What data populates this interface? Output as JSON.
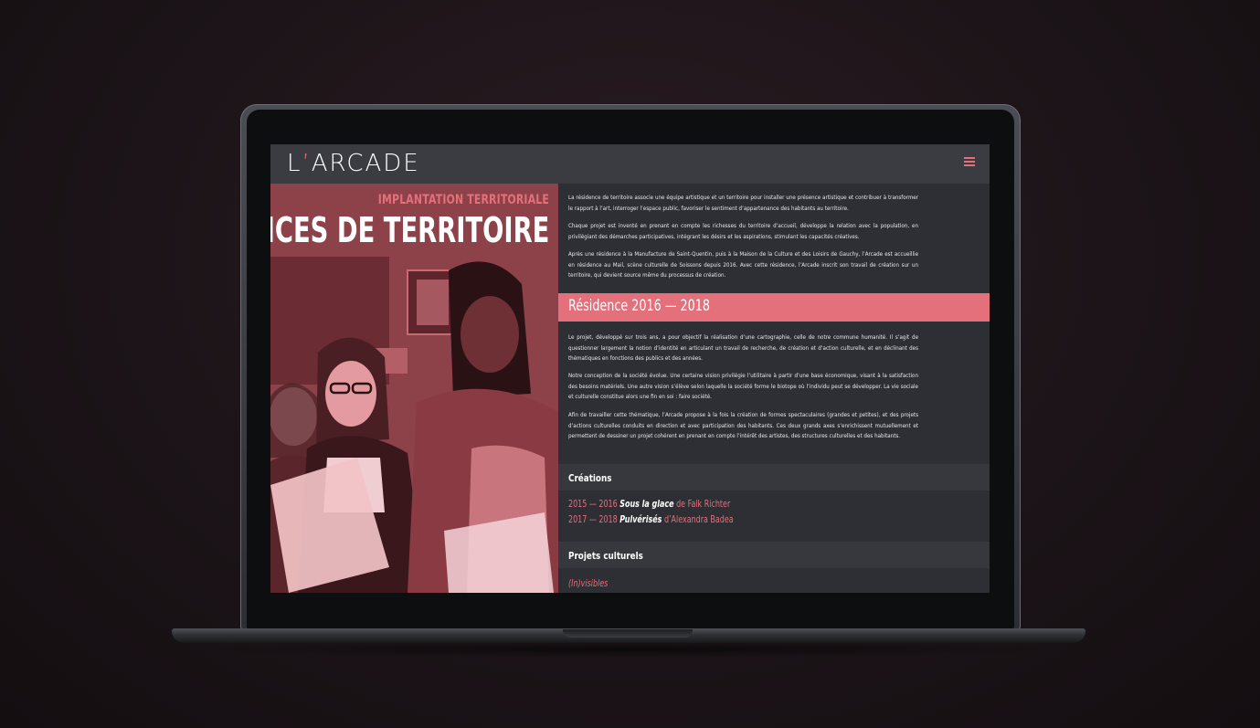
{
  "site": {
    "logo_text": "L’ARCADE",
    "menu_icon": "hamburger-icon",
    "accent_color": "#e3707a"
  },
  "hero": {
    "eyebrow": "IMPLANTATION TERRITORIALE",
    "title": "RÉSIDENCES DE TERRITOIRE"
  },
  "intro": {
    "paragraphs": [
      "La résidence de territoire associe une équipe artistique et un territoire pour installer une présence artistique et contribuer à transformer le rapport à l’art, interroger l’espace public, favoriser le sentiment d’appartenance des habitants au territoire.",
      "Chaque projet est inventé en prenant en compte les richesses du territoire d’accueil, développe la relation avec la population, en privilégiant des démarches participatives, intégrant les désirs et les aspirations, stimulant les capacités créatives.",
      "Après une résidence à la Manufacture de Saint-Quentin, puis à la Maison de la Culture et des Loisirs de Gauchy, l’Arcade est accueillie en résidence au Mail, scène culturelle de Soissons depuis 2016. Avec cette résidence, l’Arcade inscrit son travail de création sur un territoire, qui devient source même du processus de création."
    ]
  },
  "residence": {
    "heading": "Résidence 2016 — 2018",
    "paragraphs": [
      "Le projet, développé sur trois ans, a pour objectif la réalisation d’une cartographie, celle de notre commune humanité. Il s’agit de questionner largement la notion d’identité en articulant un travail de recherche, de création et d’action culturelle, et en déclinant des thématiques en fonctions des publics et des années.",
      "Notre conception de la société évolue. Une certaine vision privilégie l’utilitaire à partir d’une base économique, visant à la satisfaction des besoins matériels. Une autre vision s’élève selon laquelle la société forme le biotope où l’individu peut se développer. La vie sociale et culturelle constitue alors une fin en soi : faire société.",
      "Afin de travailler cette thématique, l’Arcade propose à la fois la création de formes spectaculaires (grandes et petites), et des projets d’actions culturelles conduits en direction et avec participation des habitants. Ces deux grands axes s’enrichissent mutuellement et permettent de dessiner un projet cohérent en prenant en compte l’intérêt des artistes, des structures culturelles et des habitants."
    ]
  },
  "creations": {
    "heading": "Créations",
    "items": [
      {
        "years": "2015 — 2016",
        "work": "Sous la glace",
        "author": "de Falk Richter"
      },
      {
        "years": "2017 — 2018",
        "work": "Pulvérisés",
        "author": "d’Alexandra Badea"
      }
    ]
  },
  "projects": {
    "heading": "Projets culturels",
    "items": [
      {
        "label": "(In)visibles"
      }
    ]
  }
}
